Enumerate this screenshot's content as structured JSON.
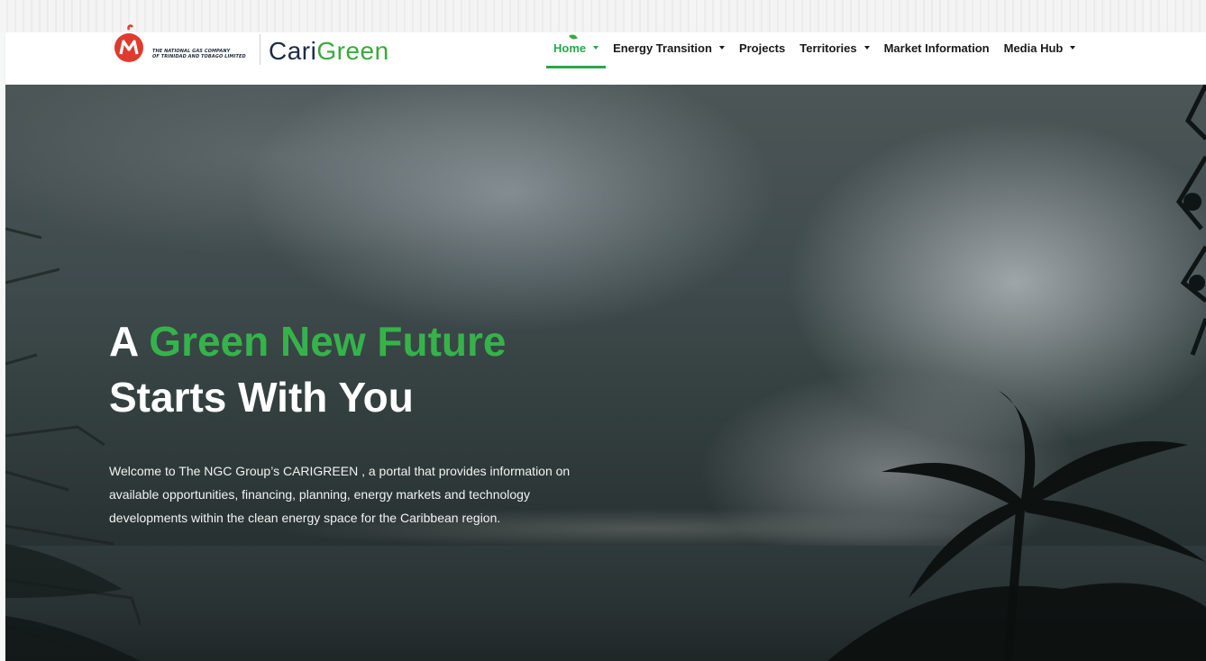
{
  "header": {
    "ngc_text_line1": "THE NATIONAL GAS COMPANY",
    "ngc_text_line2": "OF TRINIDAD AND TOBAGO LIMITED",
    "brand_prefix": "Cari",
    "brand_suffix": "Green",
    "nav": [
      {
        "label": "Home",
        "has_dropdown": true,
        "active": true
      },
      {
        "label": "Energy Transition",
        "has_dropdown": true,
        "active": false
      },
      {
        "label": "Projects",
        "has_dropdown": false,
        "active": false
      },
      {
        "label": "Territories",
        "has_dropdown": true,
        "active": false
      },
      {
        "label": "Market Information",
        "has_dropdown": false,
        "active": false
      },
      {
        "label": "Media Hub",
        "has_dropdown": true,
        "active": false
      }
    ]
  },
  "hero": {
    "title_prefix": "A ",
    "title_accent": "Green New Future",
    "title_line2": "Starts With You",
    "description": "Welcome to The NGC Group’s CARIGREEN , a portal that provides information on available opportunities, financing, planning, energy markets and technology developments within the clean energy space for the Caribbean region."
  },
  "colors": {
    "accent_green": "#27a84a",
    "brand_navy": "#1f2a44",
    "ngc_red": "#e03a2f"
  },
  "icons": {
    "logo": "ngc-logo-icon",
    "dropdown": "caret-down-icon"
  }
}
